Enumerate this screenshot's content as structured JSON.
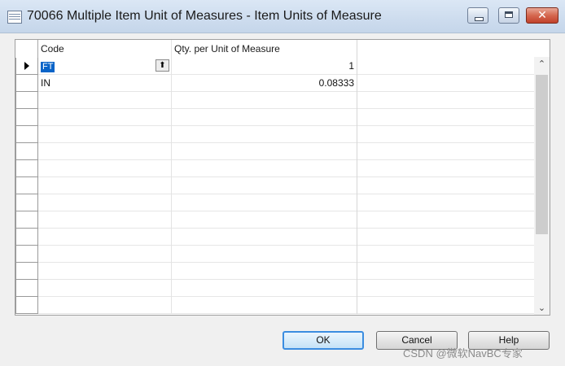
{
  "window": {
    "title": "70066 Multiple Item Unit of Measures - Item Units of Measure",
    "min_glyph": "",
    "max_glyph": "",
    "close_glyph": "✕"
  },
  "grid": {
    "headers": {
      "code": "Code",
      "qty": "Qty. per Unit of Measure"
    },
    "rows": [
      {
        "code": "FT",
        "qty": "1",
        "selected": true
      },
      {
        "code": "IN",
        "qty": "0.08333",
        "selected": false
      },
      {
        "code": "",
        "qty": ""
      },
      {
        "code": "",
        "qty": ""
      },
      {
        "code": "",
        "qty": ""
      },
      {
        "code": "",
        "qty": ""
      },
      {
        "code": "",
        "qty": ""
      },
      {
        "code": "",
        "qty": ""
      },
      {
        "code": "",
        "qty": ""
      },
      {
        "code": "",
        "qty": ""
      },
      {
        "code": "",
        "qty": ""
      },
      {
        "code": "",
        "qty": ""
      },
      {
        "code": "",
        "qty": ""
      },
      {
        "code": "",
        "qty": ""
      },
      {
        "code": "",
        "qty": ""
      }
    ],
    "lookup_glyph": "⬆",
    "scroll_up_glyph": "⌃",
    "scroll_down_glyph": "⌄"
  },
  "buttons": {
    "ok": "OK",
    "cancel": "Cancel",
    "help": "Help"
  },
  "watermark": "CSDN @微软NavBC专家"
}
